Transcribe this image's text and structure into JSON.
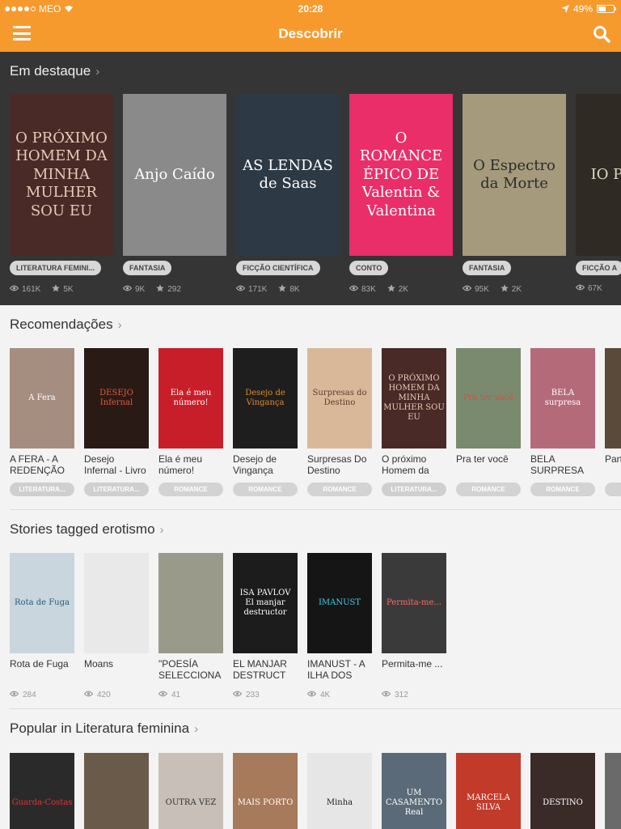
{
  "status": {
    "carrier": "MEO",
    "time": "20:28",
    "battery": "49%",
    "battery_level": 0.49
  },
  "header": {
    "title": "Descobrir"
  },
  "featured": {
    "title": "Em destaque",
    "items": [
      {
        "cover_text": "O PRÓXIMO HOMEM DA MINHA MULHER SOU EU",
        "tag": "LITERATURA FEMINI...",
        "views": "161K",
        "stars": "5K",
        "bg": "#4a2a26",
        "fg": "#e9c9b8"
      },
      {
        "cover_text": "Anjo Caído",
        "tag": "FANTASIA",
        "views": "9K",
        "stars": "292",
        "bg": "#8a8a8a",
        "fg": "#ffffff"
      },
      {
        "cover_text": "AS LENDAS de Saas",
        "tag": "FICÇÃO CIENTÍFICA",
        "views": "171K",
        "stars": "8K",
        "bg": "#2d3a45",
        "fg": "#ffffff"
      },
      {
        "cover_text": "O ROMANCE ÉPICO DE Valentin & Valentina",
        "tag": "CONTO",
        "views": "83K",
        "stars": "2K",
        "bg": "#ea2e6a",
        "fg": "#ffffff"
      },
      {
        "cover_text": "O Espectro da Morte",
        "tag": "FANTASIA",
        "views": "95K",
        "stars": "2K",
        "bg": "#a59a7c",
        "fg": "#2b2b2b"
      },
      {
        "cover_text": "IO PERSP",
        "tag": "FICÇÃO A",
        "views": "67K",
        "stars": "",
        "bg": "#2f2a24",
        "fg": "#e0d7c4"
      }
    ]
  },
  "recommendations": {
    "title": "Recomendações",
    "items": [
      {
        "title": "A FERA - A REDENÇÃO",
        "tag": "LITERATURA...",
        "bg": "#a58d80",
        "fg": "#fff",
        "cover_text": "A Fera"
      },
      {
        "title": "Desejo Infernal - Livro I",
        "tag": "LITERATURA...",
        "bg": "#2a1a16",
        "fg": "#e05a3a",
        "cover_text": "DESEJO Infernal"
      },
      {
        "title": "Ela é meu número!",
        "tag": "ROMANCE",
        "bg": "#c81e2a",
        "fg": "#fff",
        "cover_text": "Ela é meu número!"
      },
      {
        "title": "Desejo de Vingança",
        "tag": "ROMANCE",
        "bg": "#1e1e1e",
        "fg": "#e08a2a",
        "cover_text": "Desejo de Vingança"
      },
      {
        "title": "Surpresas Do Destino",
        "tag": "ROMANCE",
        "bg": "#d9b89a",
        "fg": "#5a3a2a",
        "cover_text": "Surpresas do Destino"
      },
      {
        "title": "O próximo Homem da",
        "tag": "LITERATURA...",
        "bg": "#4a2a26",
        "fg": "#e9c9b8",
        "cover_text": "O PRÓXIMO HOMEM DA MINHA MULHER SOU EU"
      },
      {
        "title": "Pra ter você",
        "tag": "ROMANCE",
        "bg": "#7a8a6e",
        "fg": "#e04a3a",
        "cover_text": "Pra ter você"
      },
      {
        "title": "BELA SURPRESA",
        "tag": "ROMANCE",
        "bg": "#b56a7a",
        "fg": "#fff",
        "cover_text": "BELA surpresa"
      },
      {
        "title": "Parte",
        "tag": "RO",
        "bg": "#5a4a3a",
        "fg": "#fff",
        "cover_text": ""
      }
    ]
  },
  "tagged": {
    "title": "Stories tagged erotismo",
    "items": [
      {
        "title": "Rota de Fuga",
        "views": "284",
        "bg": "#c9d6de",
        "fg": "#2a5a7a",
        "cover_text": "Rota de Fuga"
      },
      {
        "title": "Moans",
        "views": "420",
        "bg": "#e9e9e9",
        "fg": "#333",
        "cover_text": ""
      },
      {
        "title": "\"POESÍA SELECCIONA",
        "views": "41",
        "bg": "#9a9a8a",
        "fg": "#fff",
        "cover_text": ""
      },
      {
        "title": "EL MANJAR DESTRUCT",
        "views": "233",
        "bg": "#1c1c1c",
        "fg": "#fff",
        "cover_text": "ISA PAVLOV El manjar destructor"
      },
      {
        "title": "IMANUST - A ILHA DOS",
        "views": "4K",
        "bg": "#151515",
        "fg": "#3ad0e6",
        "cover_text": "IMANUST"
      },
      {
        "title": "Permita-me ...",
        "views": "312",
        "bg": "#3a3a3a",
        "fg": "#ff6a6a",
        "cover_text": "Permita-me..."
      }
    ]
  },
  "popular": {
    "title": "Popular in Literatura feminina",
    "items": [
      {
        "bg": "#2a2a2a",
        "fg": "#d33",
        "cover_text": "Guarda-Costas"
      },
      {
        "bg": "#6a5a4a",
        "fg": "#fff",
        "cover_text": ""
      },
      {
        "bg": "#c7bfb8",
        "fg": "#333",
        "cover_text": "OUTRA VEZ"
      },
      {
        "bg": "#a67a5a",
        "fg": "#fff",
        "cover_text": "MAIS PORTO"
      },
      {
        "bg": "#e6e6e6",
        "fg": "#222",
        "cover_text": "Minha"
      },
      {
        "bg": "#5a6a78",
        "fg": "#fff",
        "cover_text": "UM CASAMENTO Real"
      },
      {
        "bg": "#c23a2a",
        "fg": "#fff",
        "cover_text": "MARCELA SILVA"
      },
      {
        "bg": "#3a2a28",
        "fg": "#fff",
        "cover_text": "DESTINO"
      },
      {
        "bg": "#6a6a6a",
        "fg": "#fff",
        "cover_text": ""
      }
    ]
  }
}
